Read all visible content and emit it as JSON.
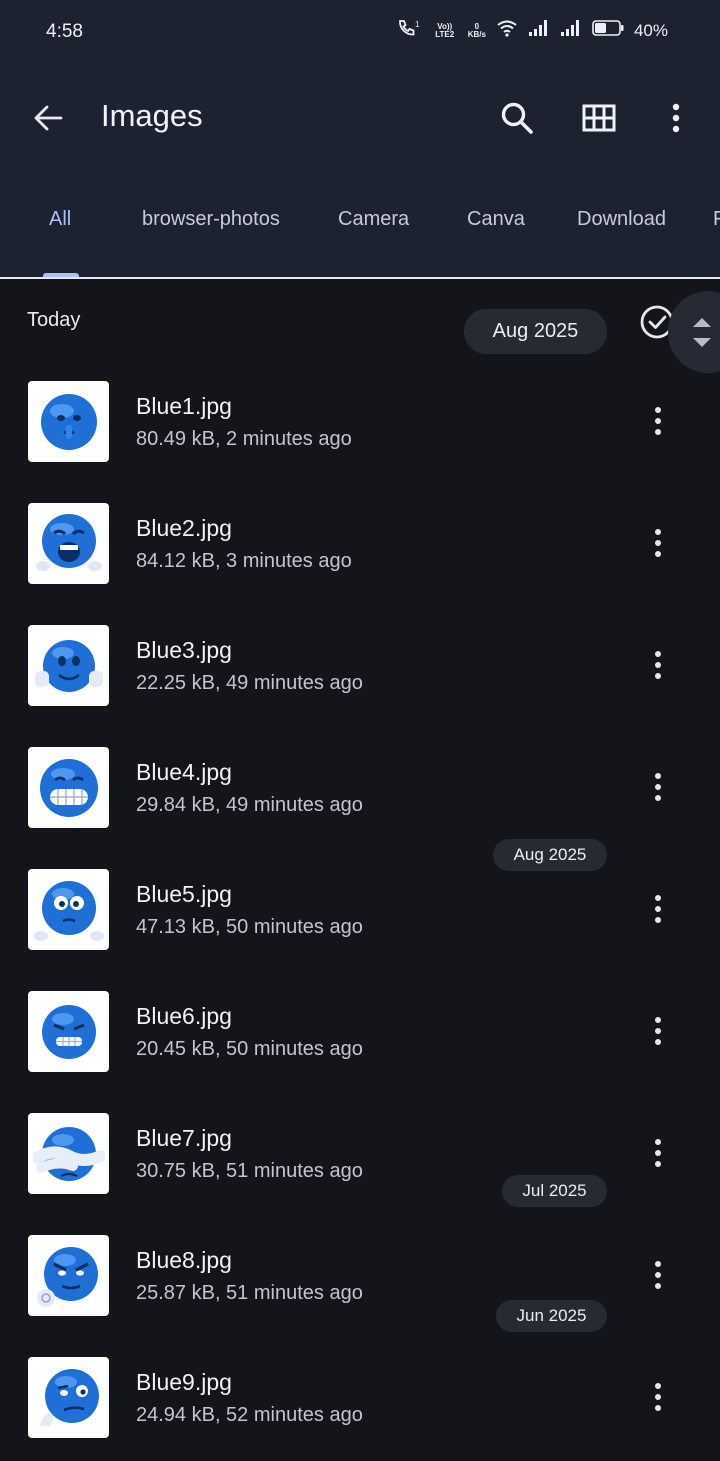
{
  "status": {
    "time": "4:58",
    "lte_label": "Vo)) LTE2",
    "speed_value": "0",
    "speed_unit": "KB/s",
    "battery": "40%"
  },
  "appbar": {
    "title": "Images",
    "back_icon": "arrow-left-icon",
    "search_icon": "search-icon",
    "grid_icon": "grid-view-icon",
    "more_icon": "more-vert-icon"
  },
  "tabs": [
    {
      "label": "All"
    },
    {
      "label": "browser-photos"
    },
    {
      "label": "Camera"
    },
    {
      "label": "Canva"
    },
    {
      "label": "Download"
    },
    {
      "label": "F"
    }
  ],
  "list": {
    "section": "Today",
    "scroll_date": "Aug 2025",
    "date_markers": [
      "Aug 2025",
      "Jul 2025",
      "Jun 2025"
    ]
  },
  "files": [
    {
      "name": "Blue1.jpg",
      "meta": "80.49 kB, 2 minutes ago"
    },
    {
      "name": "Blue2.jpg",
      "meta": "84.12 kB, 3 minutes ago"
    },
    {
      "name": "Blue3.jpg",
      "meta": "22.25 kB, 49 minutes ago"
    },
    {
      "name": "Blue4.jpg",
      "meta": "29.84 kB, 49 minutes ago"
    },
    {
      "name": "Blue5.jpg",
      "meta": "47.13 kB, 50 minutes ago"
    },
    {
      "name": "Blue6.jpg",
      "meta": "20.45 kB, 50 minutes ago"
    },
    {
      "name": "Blue7.jpg",
      "meta": "30.75 kB, 51 minutes ago"
    },
    {
      "name": "Blue8.jpg",
      "meta": "25.87 kB, 51 minutes ago"
    },
    {
      "name": "Blue9.jpg",
      "meta": "24.94 kB, 52 minutes ago"
    }
  ],
  "colors": {
    "appbar_bg": "#1d2230",
    "list_bg": "#14151a",
    "accent": "#a9c1ff",
    "emoji_blue": "#1f6fd6"
  }
}
